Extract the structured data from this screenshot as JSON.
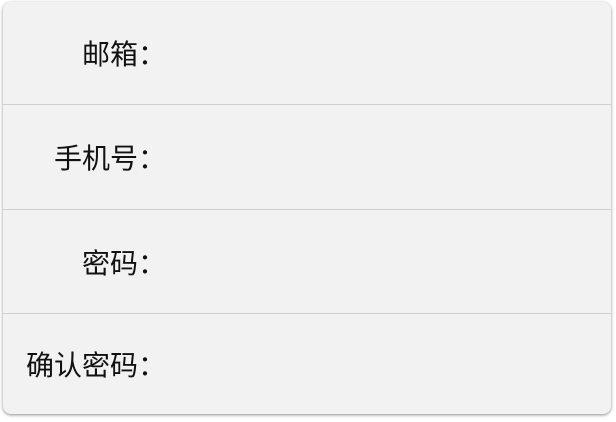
{
  "form": {
    "fields": [
      {
        "label": "邮箱：",
        "value": ""
      },
      {
        "label": "手机号：",
        "value": ""
      },
      {
        "label": "密码：",
        "value": ""
      },
      {
        "label": "确认密码：",
        "value": ""
      }
    ]
  }
}
